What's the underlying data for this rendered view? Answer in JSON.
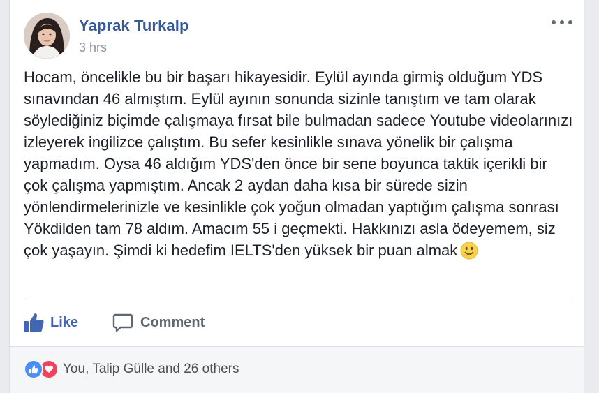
{
  "post": {
    "author": "Yaprak Turkalp",
    "timestamp": "3 hrs",
    "text": "Hocam, öncelikle bu bir başarı hikayesidir. Eylül ayında girmiş olduğum YDS sınavından 46 almıştım. Eylül ayının sonunda sizinle tanıştım ve tam olarak söylediğiniz biçimde çalışmaya fırsat bile bulmadan sadece Youtube videolarınızı izleyerek ingilizce çalıştım. Bu sefer kesinlikle sınava yönelik bir çalışma yapmadım. Oysa 46 aldığım YDS'den önce bir sene boyunca taktik içerikli bir çok çalışma yapmıştım. Ancak 2 aydan daha kısa bir sürede sizin yönlendirmelerinizle ve kesinlikle çok yoğun olmadan yaptığım çalışma sonrası Yökdilden tam 78 aldım. Amacım 55 i geçmekti. Hakkınızı asla ödeyemem, siz çok yaşayın. Şimdi ki hedefim IELTS'den yüksek bir puan almak",
    "emoji": "smiley-emoji-icon"
  },
  "actions": {
    "like_label": "Like",
    "comment_label": "Comment"
  },
  "reactions": {
    "summary": "You, Talip Gülle and 26 others",
    "types": [
      "like-reaction-icon",
      "love-reaction-icon"
    ]
  },
  "colors": {
    "author_link": "#365899",
    "like_blue": "#4267b2",
    "love_red": "#f0445e",
    "text": "#1d2129",
    "muted": "#90949c",
    "footer_bg": "#f5f6f7"
  }
}
